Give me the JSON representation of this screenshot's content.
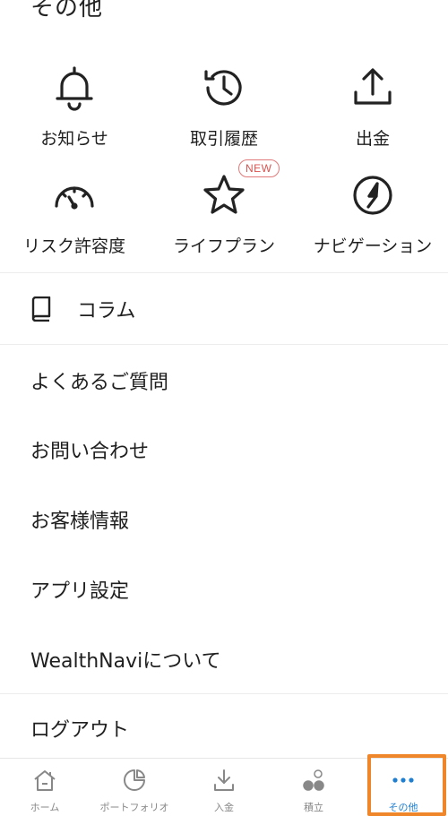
{
  "page": {
    "title": "その他"
  },
  "grid": {
    "items": [
      {
        "label": "お知らせ",
        "icon": "bell-icon"
      },
      {
        "label": "取引履歴",
        "icon": "history-icon"
      },
      {
        "label": "出金",
        "icon": "withdraw-icon"
      },
      {
        "label": "リスク許容度",
        "icon": "gauge-icon"
      },
      {
        "label": "ライフプラン",
        "icon": "star-icon",
        "badge": "NEW"
      },
      {
        "label": "ナビゲーション",
        "icon": "navigation-icon"
      }
    ]
  },
  "column": {
    "label": "コラム",
    "icon": "book-icon"
  },
  "menu": {
    "items": [
      {
        "label": "よくあるご質問"
      },
      {
        "label": "お問い合わせ"
      },
      {
        "label": "お客様情報"
      },
      {
        "label": "アプリ設定"
      },
      {
        "label": "WealthNaviについて"
      },
      {
        "label": "ログアウト"
      }
    ]
  },
  "bottom_nav": {
    "items": [
      {
        "label": "ホーム",
        "icon": "home-icon"
      },
      {
        "label": "ポートフォリオ",
        "icon": "portfolio-icon"
      },
      {
        "label": "入金",
        "icon": "deposit-icon"
      },
      {
        "label": "積立",
        "icon": "savings-icon"
      },
      {
        "label": "その他",
        "icon": "more-icon",
        "active": true
      }
    ]
  },
  "colors": {
    "accent": "#1f7fd0",
    "badge": "#d9534f",
    "highlight": "#f0862a"
  }
}
